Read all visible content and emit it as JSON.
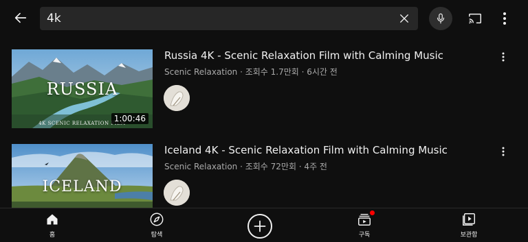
{
  "header": {
    "query": "4k",
    "icons": {
      "back": "arrow-left-icon",
      "clear": "close-icon",
      "mic": "microphone-icon",
      "cast": "cast-icon",
      "more": "more-vert-icon"
    }
  },
  "results": [
    {
      "thumbnail_title": "RUSSIA",
      "thumbnail_subtitle": "4K SCENIC RELAXATION FILM",
      "duration": "1:00:46",
      "title": "Russia 4K - Scenic Relaxation Film with Calming Music",
      "meta": "Scenic Relaxation · 조회수 1.7만회 · 6시간 전"
    },
    {
      "thumbnail_title": "ICELAND",
      "title": "Iceland 4K - Scenic Relaxation Film with Calming Music",
      "meta": "Scenic Relaxation · 조회수 72만회 · 4주 전"
    }
  ],
  "bottom_nav": {
    "home": "홈",
    "explore": "탐색",
    "subscriptions": "구독",
    "library": "보관함",
    "icons": {
      "home": "home-icon",
      "explore": "compass-icon",
      "create": "plus-circle-icon",
      "subscriptions": "subscriptions-icon",
      "library": "library-icon"
    }
  },
  "colors": {
    "background": "#0f0f0f",
    "search_box": "#272727",
    "secondary_text": "#aaaaaa",
    "notification": "#ff0000"
  }
}
